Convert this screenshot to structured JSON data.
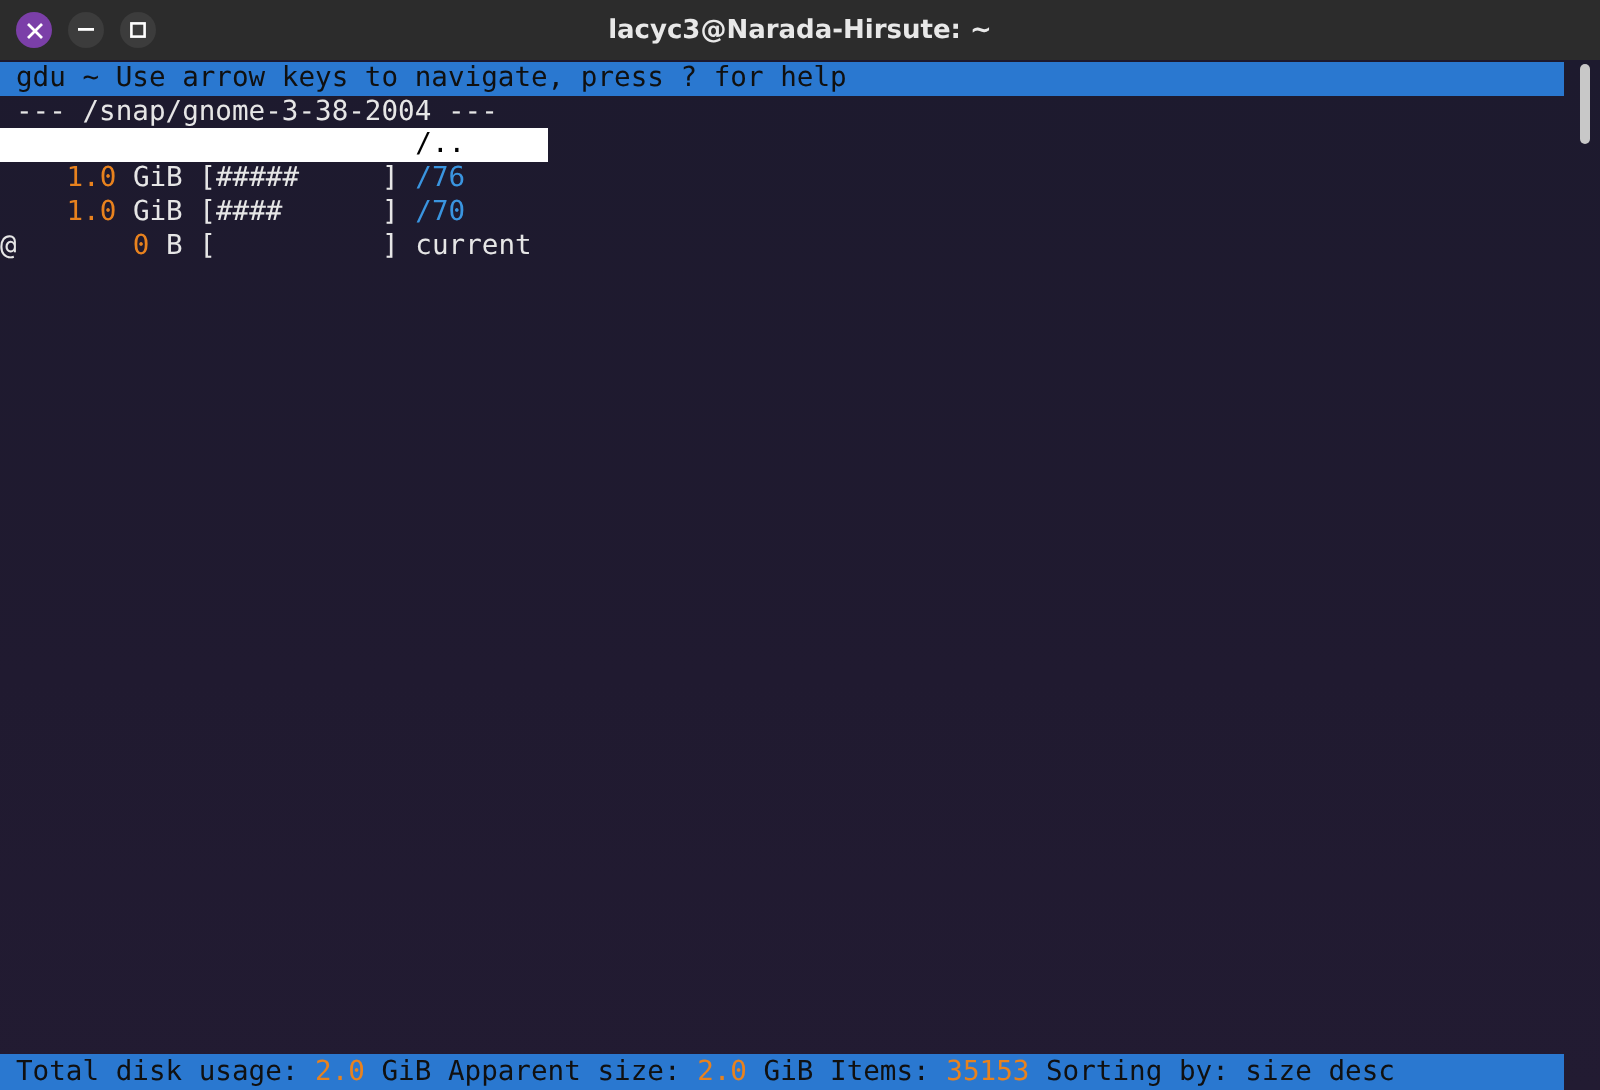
{
  "window": {
    "title": "lacyc3@Narada-Hirsute: ~"
  },
  "header": "gdu ~ Use arrow keys to navigate, press ? for help",
  "path_line": "--- /snap/gnome-3-38-2004 ---",
  "rows": [
    {
      "kind": "parent",
      "flag": "",
      "size": "",
      "unit": "",
      "bar": "",
      "name": "/..",
      "selected": true
    },
    {
      "kind": "dir",
      "flag": "",
      "size": "1.0",
      "unit": "GiB",
      "bar": "[#####     ]",
      "name": "/76",
      "selected": false
    },
    {
      "kind": "dir",
      "flag": "",
      "size": "1.0",
      "unit": "GiB",
      "bar": "[####      ]",
      "name": "/70",
      "selected": false
    },
    {
      "kind": "file",
      "flag": "@",
      "size": "0",
      "unit": "B",
      "bar": "[          ]",
      "name": "current",
      "selected": false
    }
  ],
  "status_bar": [
    {
      "kind": "label",
      "text": "Total disk usage:"
    },
    {
      "kind": "value",
      "text": "2.0"
    },
    {
      "kind": "label",
      "text": "GiB Apparent size:"
    },
    {
      "kind": "value",
      "text": "2.0"
    },
    {
      "kind": "label",
      "text": "GiB Items:"
    },
    {
      "kind": "value",
      "text": "35153"
    },
    {
      "kind": "label",
      "text": "Sorting by: size desc"
    }
  ]
}
